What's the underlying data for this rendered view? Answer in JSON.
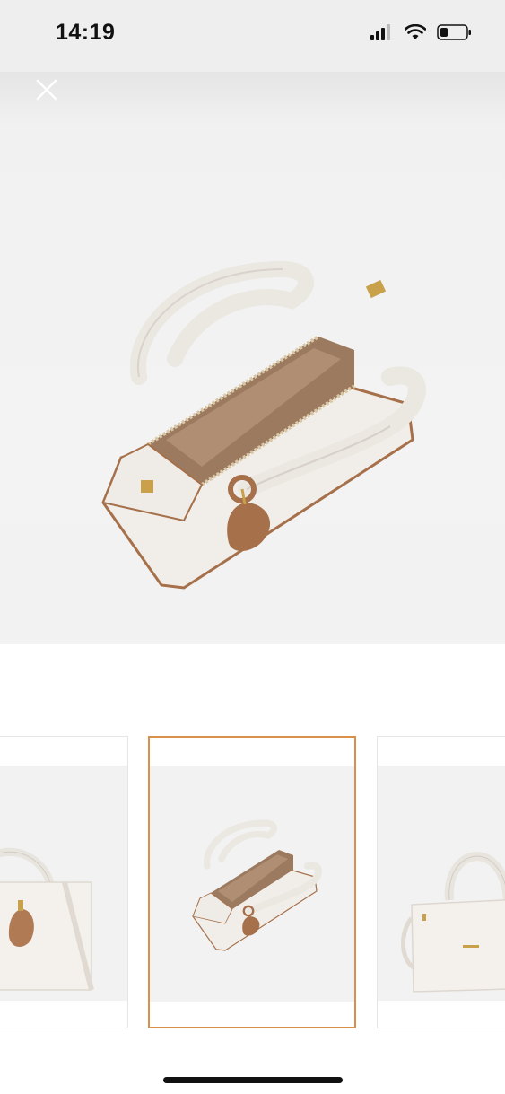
{
  "status_bar": {
    "time": "14:19",
    "icons": [
      "signal-icon",
      "wifi-icon",
      "battery-icon"
    ]
  },
  "viewer": {
    "close_icon": "close-icon",
    "thumbnails": [
      {
        "name": "bag-front-view",
        "selected": false
      },
      {
        "name": "bag-open-top-view",
        "selected": true
      },
      {
        "name": "bag-side-view",
        "selected": false
      }
    ],
    "selected_index": 1
  },
  "colors": {
    "selected_border": "#d9904a",
    "bag_leather": "#f1eeea",
    "bag_trim": "#a5704a",
    "bag_lining": "#9c7a5f",
    "hardware_gold": "#c9a14a"
  }
}
